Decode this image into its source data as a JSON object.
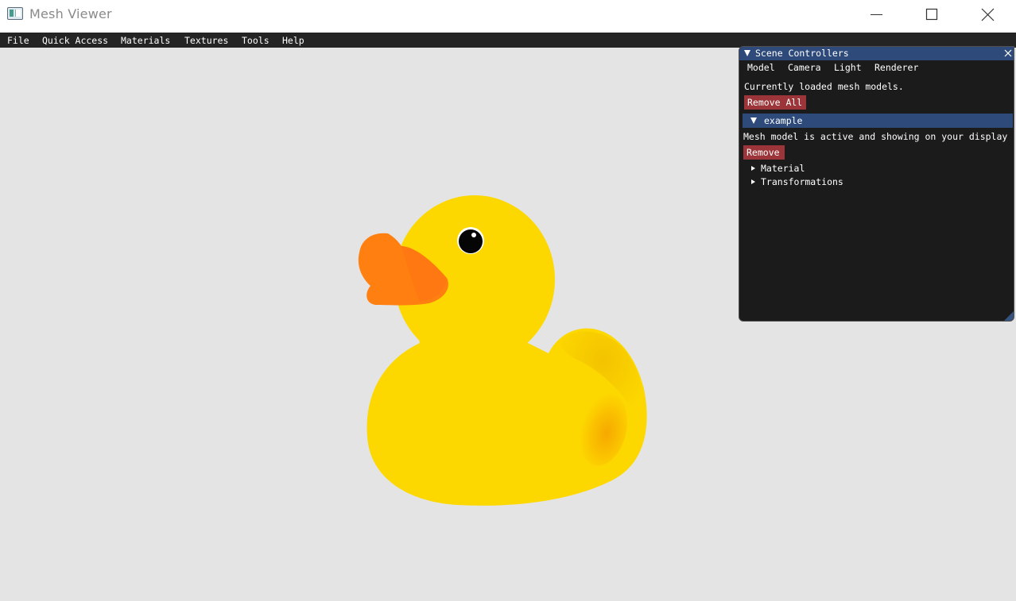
{
  "window": {
    "title": "Mesh Viewer",
    "icons": {
      "app": "app-window-icon",
      "minimize": "minimize-icon",
      "maximize": "maximize-icon",
      "close": "close-icon"
    }
  },
  "menubar": {
    "items": [
      "File",
      "Quick Access",
      "Materials",
      "Textures",
      "Tools",
      "Help"
    ]
  },
  "viewport": {
    "background": "#e4e4e4",
    "model_colors": {
      "body": "#fdd800",
      "beak": "#ff7f11",
      "eye": "#000000"
    }
  },
  "panel": {
    "title": "Scene Controllers",
    "tabs": [
      "Model",
      "Camera",
      "Light",
      "Renderer"
    ],
    "description": "Currently loaded mesh models.",
    "remove_all_label": "Remove All",
    "model": {
      "name": "example",
      "status": "Mesh model is active and showing on your display",
      "remove_label": "Remove",
      "sections": [
        "Material",
        "Transformations"
      ]
    },
    "colors": {
      "header": "#2d4a7a",
      "background": "#1b1b1b",
      "danger_button": "#9b3539"
    }
  }
}
